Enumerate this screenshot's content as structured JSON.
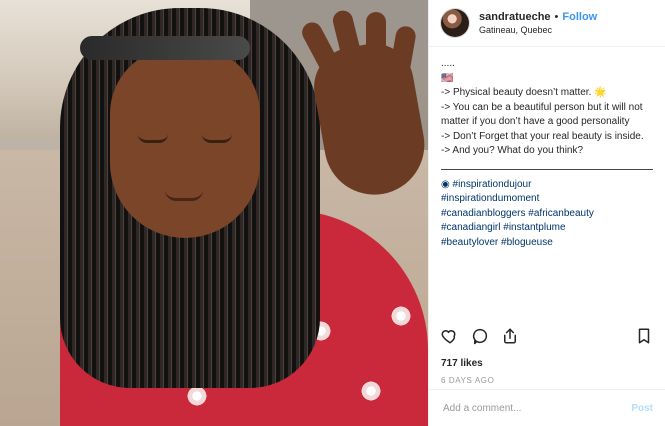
{
  "header": {
    "username": "sandratueche",
    "separator": "•",
    "follow_label": "Follow",
    "location": "Gatineau, Quebec"
  },
  "caption": {
    "lines": [
      ".....",
      "🇺🇸",
      "-> Physical beauty doesn’t matter. 🌟",
      "-> You can be a beautiful person but it will not matter if you don’t have a good personality",
      "-> Don’t Forget that your real beauty is inside.",
      "-> And you? What do you think?"
    ],
    "hashtags": [
      "◉ #inspirationdujour",
      "#inspirationdumoment",
      "#canadianbloggers #africanbeauty",
      "#canadiangirl #instantplume",
      "#beautylover #blogueuse"
    ]
  },
  "actions": {
    "like_icon": "heart-icon",
    "comment_icon": "comment-icon",
    "share_icon": "share-icon",
    "save_icon": "bookmark-icon"
  },
  "stats": {
    "likes": "717 likes",
    "date": "6 DAYS AGO"
  },
  "composer": {
    "placeholder": "Add a comment...",
    "post_label": "Post"
  }
}
